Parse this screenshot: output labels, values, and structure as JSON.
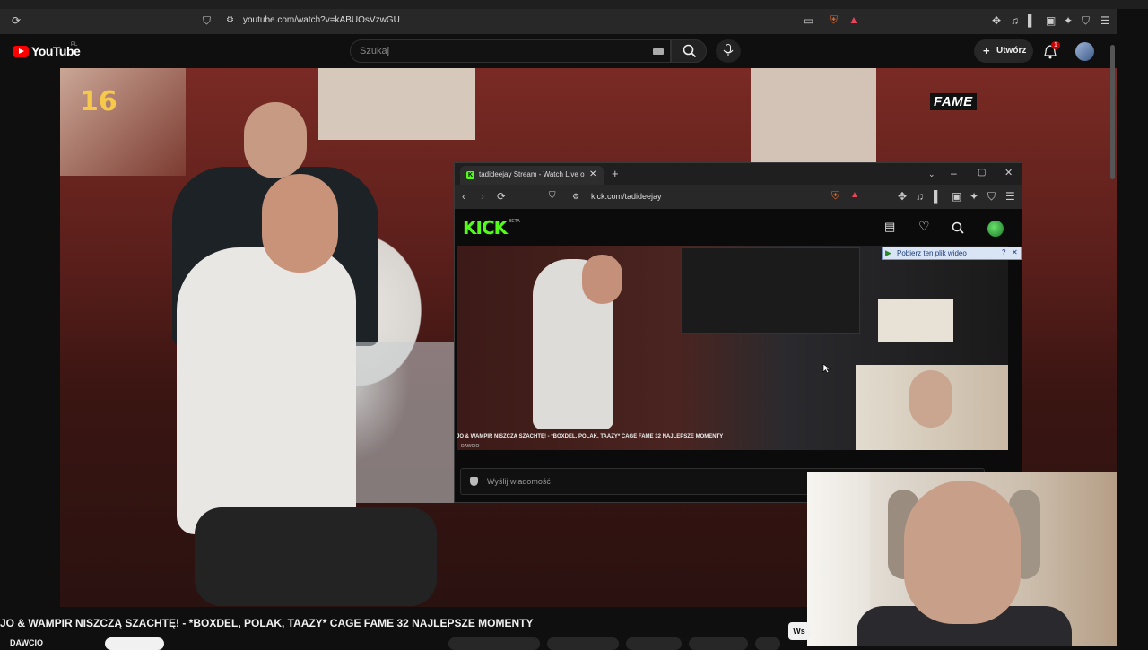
{
  "browser": {
    "url": "youtube.com/watch?v=kABUOsVzwGU"
  },
  "youtube": {
    "logo_text": "YouTube",
    "region": "PL",
    "search_placeholder": "Szukaj",
    "create_label": "Utwórz",
    "notification_count": "1"
  },
  "video": {
    "age_rating": "16",
    "brand": "FAME",
    "title": "JO & WAMPIR NISZCZĄ SZACHTĘ! - *BOXDEL, POLAK, TAAZY* CAGE FAME 32 NAJLEPSZE MOMENTY",
    "channel": "DAWCIO",
    "overlay_button": "Ws"
  },
  "popup_browser": {
    "tab_title": "tadideejay Stream - Watch Live o",
    "url": "kick.com/tadideejay",
    "logo": "KICK",
    "logo_badge": "BETA",
    "download_bar": "Pobierz ten plik wideo",
    "inner_title": "JO & WAMPIR NISZCZĄ SZACHTĘ! - *BOXDEL, POLAK, TAAZY* CAGE FAME 32 NAJLEPSZE MOMENTY",
    "inner_channel": "DAWCIO",
    "chat_placeholder": "Wyślij wiadomość"
  }
}
